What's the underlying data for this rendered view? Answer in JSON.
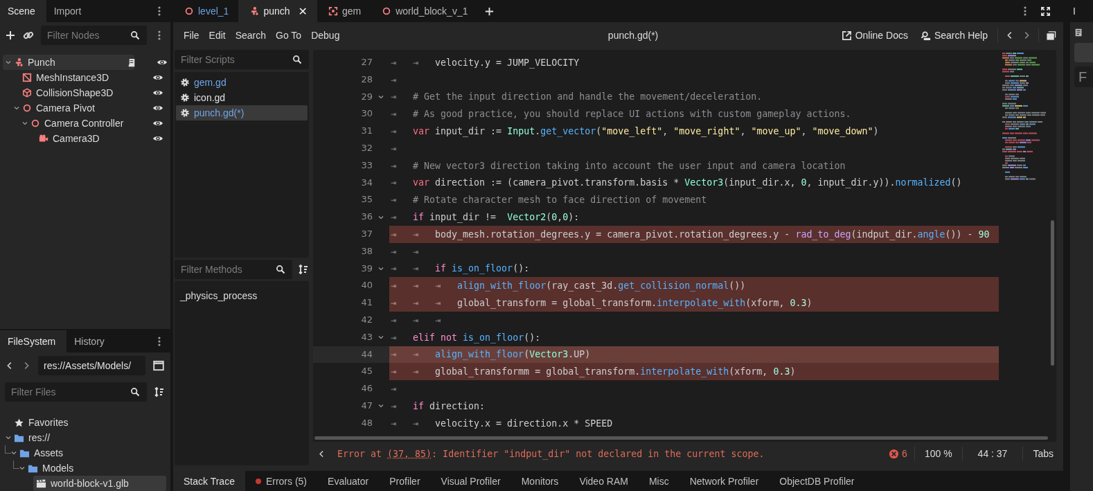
{
  "scene_dock": {
    "tabs": [
      {
        "label": "Scene",
        "selected": true
      },
      {
        "label": "Import",
        "selected": false
      }
    ],
    "filter": {
      "placeholder": "Filter Nodes"
    },
    "tree": [
      {
        "name": "Punch",
        "kind": "character",
        "script": true,
        "selected": true,
        "expanded": true,
        "children": [
          {
            "name": "MeshInstance3D",
            "kind": "mesh",
            "script": false,
            "selected": false
          },
          {
            "name": "CollisionShape3D",
            "kind": "collision",
            "script": false,
            "selected": false
          },
          {
            "name": "Camera Pivot",
            "kind": "node",
            "script": false,
            "selected": false,
            "expanded": true,
            "children": [
              {
                "name": "Camera Controller",
                "kind": "node",
                "script": false,
                "selected": false,
                "expanded": true,
                "children": [
                  {
                    "name": "Camera3D",
                    "kind": "camera",
                    "script": false,
                    "selected": false
                  }
                ]
              }
            ]
          }
        ]
      }
    ]
  },
  "filesystem_dock": {
    "tabs": [
      {
        "label": "FileSystem",
        "selected": true
      },
      {
        "label": "History",
        "selected": false
      }
    ],
    "path": "res://Assets/Models/",
    "filter": {
      "placeholder": "Filter Files"
    },
    "tree": [
      {
        "label": "Favorites",
        "kind": "favorites",
        "selected": false
      },
      {
        "label": "res://",
        "kind": "folder",
        "selected": false,
        "expanded": true,
        "children": [
          {
            "label": "Assets",
            "kind": "folder",
            "selected": false,
            "expanded": true,
            "children": [
              {
                "label": "Models",
                "kind": "folder",
                "selected": false,
                "expanded": true,
                "children": [
                  {
                    "label": "world-block-v1.glb",
                    "kind": "scene",
                    "selected": true
                  }
                ]
              }
            ]
          }
        ]
      }
    ]
  },
  "scene_tabs": [
    {
      "label": "level_1",
      "kind": "node",
      "selected": false,
      "color": "#6ea0e0"
    },
    {
      "label": "punch",
      "kind": "character",
      "selected": true,
      "color": "#e6e6e6",
      "close": "✕"
    },
    {
      "label": "gem",
      "kind": "mesh",
      "selected": false,
      "color": "#b8b8b8"
    },
    {
      "label": "world_block_v_1",
      "kind": "node",
      "selected": false,
      "color": "#b8b8b8"
    }
  ],
  "script_menu": [
    "File",
    "Edit",
    "Search",
    "Go To",
    "Debug"
  ],
  "script_title": "punch.gd(*)",
  "help_buttons": [
    {
      "label": "Online Docs",
      "kind": "docs"
    },
    {
      "label": "Search Help",
      "kind": "search"
    }
  ],
  "scripts": {
    "filter": {
      "placeholder": "Filter Scripts"
    },
    "items": [
      {
        "label": "gem.gd",
        "selected": false,
        "color": "#6ea5e6"
      },
      {
        "label": "icon.gd",
        "selected": false,
        "color": "#e0e0e0"
      },
      {
        "label": "punch.gd(*)",
        "selected": true,
        "color": "#6ea5e6"
      }
    ]
  },
  "methods": {
    "filter": {
      "placeholder": "Filter Methods"
    },
    "items": [
      "_physics_process"
    ]
  },
  "code": [
    {
      "number": "27",
      "indent": "⇥⇥",
      "foldable": false,
      "error": false,
      "current": false,
      "tokens": [
        {
          "kind": "text",
          "text": "velocity.y = JUMP_VELOCITY"
        }
      ]
    },
    {
      "number": "28",
      "indent": "⇥",
      "foldable": false,
      "error": false,
      "current": false
    },
    {
      "number": "29",
      "indent": "⇥",
      "foldable": true,
      "error": false,
      "current": false,
      "tokens": [
        {
          "kind": "comment",
          "text": "# Get the input direction and handle the movement/deceleration."
        }
      ]
    },
    {
      "number": "30",
      "indent": "⇥",
      "foldable": false,
      "error": false,
      "current": false,
      "tokens": [
        {
          "kind": "comment",
          "text": "# As good practice, you should replace UI actions with custom gameplay actions."
        }
      ]
    },
    {
      "number": "31",
      "indent": "⇥",
      "foldable": false,
      "error": false,
      "current": false,
      "tokens": [
        {
          "kind": "keyword",
          "text": "var"
        },
        {
          "kind": "text",
          "text": " input_dir := "
        },
        {
          "kind": "type",
          "text": "Input"
        },
        {
          "kind": "text",
          "text": "."
        },
        {
          "kind": "func",
          "text": "get_vector"
        },
        {
          "kind": "text",
          "text": "("
        },
        {
          "kind": "string",
          "text": "\"move_left\""
        },
        {
          "kind": "text",
          "text": ", "
        },
        {
          "kind": "string",
          "text": "\"move_right\""
        },
        {
          "kind": "text",
          "text": ", "
        },
        {
          "kind": "string",
          "text": "\"move_up\""
        },
        {
          "kind": "text",
          "text": ", "
        },
        {
          "kind": "string",
          "text": "\"move_down\""
        },
        {
          "kind": "text",
          "text": ")"
        }
      ]
    },
    {
      "number": "32",
      "indent": "⇥",
      "foldable": false,
      "error": false,
      "current": false
    },
    {
      "number": "33",
      "indent": "⇥",
      "foldable": false,
      "error": false,
      "current": false,
      "tokens": [
        {
          "kind": "comment",
          "text": "# New vector3 direction taking into account the user input and camera location"
        }
      ]
    },
    {
      "number": "34",
      "indent": "⇥",
      "foldable": false,
      "error": false,
      "current": false,
      "tokens": [
        {
          "kind": "keyword",
          "text": "var"
        },
        {
          "kind": "text",
          "text": " direction := (camera_pivot.transform.basis * "
        },
        {
          "kind": "type",
          "text": "Vector3"
        },
        {
          "kind": "text",
          "text": "(input_dir.x, "
        },
        {
          "kind": "number",
          "text": "0"
        },
        {
          "kind": "text",
          "text": ", input_dir.y))."
        },
        {
          "kind": "func",
          "text": "normalized"
        },
        {
          "kind": "text",
          "text": "()"
        }
      ]
    },
    {
      "number": "35",
      "indent": "⇥",
      "foldable": false,
      "error": false,
      "current": false,
      "tokens": [
        {
          "kind": "comment",
          "text": "# Rotate character mesh to face direction of movement"
        }
      ]
    },
    {
      "number": "36",
      "indent": "⇥",
      "foldable": true,
      "error": false,
      "current": false,
      "tokens": [
        {
          "kind": "control",
          "text": "if"
        },
        {
          "kind": "text",
          "text": " input_dir !=  "
        },
        {
          "kind": "type",
          "text": "Vector2"
        },
        {
          "kind": "text",
          "text": "("
        },
        {
          "kind": "number",
          "text": "0"
        },
        {
          "kind": "text",
          "text": ","
        },
        {
          "kind": "number",
          "text": "0"
        },
        {
          "kind": "text",
          "text": "):"
        }
      ]
    },
    {
      "number": "37",
      "indent": "⇥⇥",
      "foldable": false,
      "error": true,
      "current": false,
      "tokens": [
        {
          "kind": "text",
          "text": "body_mesh.rotation_degrees.y = camera_pivot.rotation_degrees.y - "
        },
        {
          "kind": "utility",
          "text": "rad_to_deg"
        },
        {
          "kind": "text",
          "text": "(indput_dir."
        },
        {
          "kind": "func",
          "text": "angle"
        },
        {
          "kind": "text",
          "text": "()) - "
        },
        {
          "kind": "number",
          "text": "90"
        }
      ]
    },
    {
      "number": "38",
      "indent": "⇥⇥",
      "foldable": false,
      "error": false,
      "current": false
    },
    {
      "number": "39",
      "indent": "⇥⇥",
      "foldable": true,
      "error": false,
      "current": false,
      "tokens": [
        {
          "kind": "control",
          "text": "if"
        },
        {
          "kind": "func",
          "text": " is_on_floor"
        },
        {
          "kind": "text",
          "text": "():"
        }
      ]
    },
    {
      "number": "40",
      "indent": "⇥⇥⇥",
      "foldable": false,
      "error": true,
      "current": false,
      "tokens": [
        {
          "kind": "func",
          "text": "align_with_floor"
        },
        {
          "kind": "text",
          "text": "(ray_cast_3d."
        },
        {
          "kind": "func",
          "text": "get_collision_normal"
        },
        {
          "kind": "text",
          "text": "())"
        }
      ]
    },
    {
      "number": "41",
      "indent": "⇥⇥⇥",
      "foldable": false,
      "error": true,
      "current": false,
      "tokens": [
        {
          "kind": "text",
          "text": "global_transform = global_transform."
        },
        {
          "kind": "func",
          "text": "interpolate_with"
        },
        {
          "kind": "text",
          "text": "(xform, "
        },
        {
          "kind": "number",
          "text": "0.3"
        },
        {
          "kind": "text",
          "text": ")"
        }
      ]
    },
    {
      "number": "42",
      "indent": "⇥⇥⇥",
      "foldable": false,
      "error": false,
      "current": false
    },
    {
      "number": "43",
      "indent": "⇥",
      "foldable": true,
      "error": false,
      "current": false,
      "tokens": [
        {
          "kind": "control",
          "text": "elif"
        },
        {
          "kind": "control",
          "text": " not"
        },
        {
          "kind": "func",
          "text": " is_on_floor"
        },
        {
          "kind": "text",
          "text": "():"
        }
      ]
    },
    {
      "number": "44",
      "indent": "⇥⇥",
      "foldable": false,
      "error": true,
      "current": true,
      "tokens": [
        {
          "kind": "func",
          "text": "align_with_floor"
        },
        {
          "kind": "text",
          "text": "("
        },
        {
          "kind": "type",
          "text": "Vector3"
        },
        {
          "kind": "text",
          "text": ".UP)"
        }
      ]
    },
    {
      "number": "45",
      "indent": "⇥⇥",
      "foldable": false,
      "error": true,
      "current": false,
      "tokens": [
        {
          "kind": "text",
          "text": "global_transformm = global_transform."
        },
        {
          "kind": "func",
          "text": "interpolate_with"
        },
        {
          "kind": "text",
          "text": "(xform, "
        },
        {
          "kind": "number",
          "text": "0.3"
        },
        {
          "kind": "text",
          "text": ")"
        }
      ]
    },
    {
      "number": "46",
      "indent": "⇥",
      "foldable": false,
      "error": false,
      "current": false
    },
    {
      "number": "47",
      "indent": "⇥",
      "foldable": true,
      "error": false,
      "current": false,
      "tokens": [
        {
          "kind": "control",
          "text": "if"
        },
        {
          "kind": "text",
          "text": " direction:"
        }
      ]
    },
    {
      "number": "48",
      "indent": "⇥⇥",
      "foldable": false,
      "error": false,
      "current": false,
      "tokens": [
        {
          "kind": "text",
          "text": "velocity.x = direction.x * SPEED"
        }
      ]
    }
  ],
  "status": {
    "error_prefix": "Error at ",
    "error_location": "(37, 85)",
    "error_message": ": Identifier \"indput_dir\" not declared in the current scope.",
    "error_count": "6",
    "zoom": "100 %",
    "cursor": "44 : 37",
    "indent_mode": "Tabs"
  },
  "bottom_tabs": [
    {
      "label": "Stack Trace",
      "selected": true
    },
    {
      "label": "Errors (5)",
      "selected": false,
      "color": "#c8372d"
    },
    {
      "label": "Evaluator",
      "selected": false
    },
    {
      "label": "Profiler",
      "selected": false
    },
    {
      "label": "Visual Profiler",
      "selected": false
    },
    {
      "label": "Monitors",
      "selected": false
    },
    {
      "label": "Video RAM",
      "selected": false
    },
    {
      "label": "Misc",
      "selected": false
    },
    {
      "label": "Network Profiler",
      "selected": false
    },
    {
      "label": "ObjectDB Profiler",
      "selected": false
    }
  ],
  "right_dock": {
    "tab": "I",
    "field": "F"
  }
}
